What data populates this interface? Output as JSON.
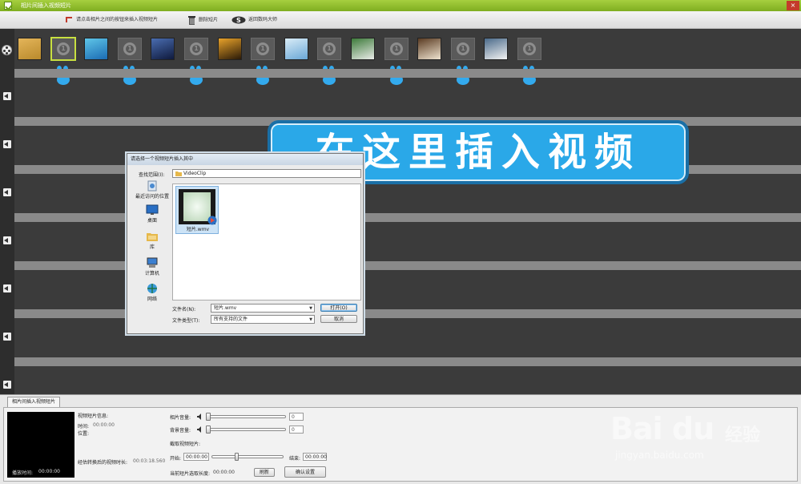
{
  "window": {
    "title": "相片间插入视频短片",
    "close_label": "×"
  },
  "toolbar": {
    "insert_hint": "请点击相片之间的按钮来插入视频短片",
    "delete_clip": "删除短片",
    "back_label": "返回数码大师"
  },
  "timeline": {
    "slots": [
      {
        "kind": "photo",
        "colors": [
          "#b98a2c",
          "#e4b55a"
        ]
      },
      {
        "kind": "slot",
        "label": "1",
        "selected": true
      },
      {
        "kind": "photo",
        "colors": [
          "#1b6bb3",
          "#5fc6e8"
        ]
      },
      {
        "kind": "slot",
        "label": "1"
      },
      {
        "kind": "photo",
        "colors": [
          "#0f1a3d",
          "#4a6db0"
        ]
      },
      {
        "kind": "slot",
        "label": "1"
      },
      {
        "kind": "photo",
        "colors": [
          "#2a1a08",
          "#e8a22a"
        ]
      },
      {
        "kind": "slot",
        "label": "1"
      },
      {
        "kind": "photo",
        "colors": [
          "#6aa7d6",
          "#d9ecf7"
        ]
      },
      {
        "kind": "slot",
        "label": "1"
      },
      {
        "kind": "photo",
        "colors": [
          "#e9ece8",
          "#3d7a3a"
        ]
      },
      {
        "kind": "slot",
        "label": "1"
      },
      {
        "kind": "photo",
        "colors": [
          "#efe3cf",
          "#5a3b22"
        ]
      },
      {
        "kind": "slot",
        "label": "1"
      },
      {
        "kind": "photo",
        "colors": [
          "#f3f3f3",
          "#4a6a8a"
        ]
      },
      {
        "kind": "slot",
        "label": "1"
      }
    ]
  },
  "banner": {
    "text": "在这里插入视频"
  },
  "dialog": {
    "title": "请选择一个视频短片插入其中",
    "lookin_label": "查找范围(I):",
    "lookin_value": "VideoClip",
    "places": [
      {
        "label": "最近访问的位置",
        "icon": "recent-places-icon"
      },
      {
        "label": "桌面",
        "icon": "desktop-icon"
      },
      {
        "label": "库",
        "icon": "library-icon"
      },
      {
        "label": "计算机",
        "icon": "computer-icon"
      },
      {
        "label": "网络",
        "icon": "network-icon"
      }
    ],
    "file_name": "短片.wmv",
    "filename_label": "文件名(N):",
    "filename_value": "短片.wmv",
    "filetype_label": "文件类型(T):",
    "filetype_value": "所有支持的文件",
    "open_button": "打开(O)",
    "cancel_button": "取消"
  },
  "bottom": {
    "tab_label": "相片间插入视频短片",
    "preview_time_label": "播放时间:",
    "preview_time_value": "00:00:00",
    "info_title": "视频短片信息:",
    "duration_label": "时间:",
    "duration_value": "00:00:00",
    "position_label": "位置:",
    "converted_label": "经估转换后的视频时长:",
    "converted_value": "00:03:18.560",
    "photo_volume_label": "相片音量:",
    "photo_volume_value": "0",
    "bg_volume_label": "背景音量:",
    "bg_volume_value": "0",
    "trim_label": "截取视频短片:",
    "start_label": "开始:",
    "start_value": "00:00:00",
    "end_label": "结束:",
    "end_value": "00:00:00",
    "selected_len_label": "当前短片选取长度:",
    "selected_len_value": "00:00:00",
    "refresh_button": "刷新",
    "confirm_button": "确认设置"
  },
  "watermark": {
    "brand": "Bai du",
    "jy": "经验",
    "url": "jingyan.baidu.com"
  }
}
